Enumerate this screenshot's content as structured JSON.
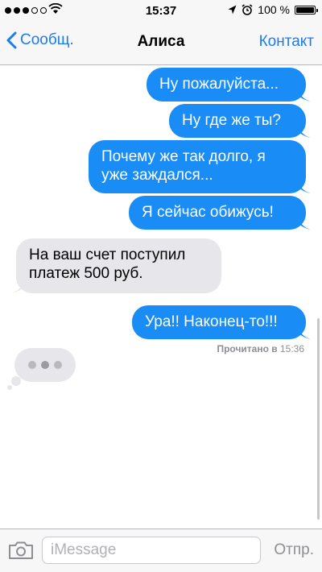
{
  "status_bar": {
    "time": "15:37",
    "battery_text": "100 %",
    "battery_level_pct": 100,
    "signal_bars_filled": 3,
    "signal_bars_total": 5
  },
  "nav": {
    "back_label": "Сообщ.",
    "title": "Алиса",
    "contact_label": "Контакт"
  },
  "messages": [
    {
      "direction": "outgoing",
      "text": "Ну пожалуйста..."
    },
    {
      "direction": "outgoing",
      "text": "Ну где же ты?"
    },
    {
      "direction": "outgoing",
      "line1": "Почему же так долго, я",
      "line2": "уже заждался..."
    },
    {
      "direction": "outgoing",
      "text": "Я сейчас обижусь!"
    },
    {
      "direction": "incoming",
      "line1": "На ваш счет поступил",
      "line2": "платеж 500 руб."
    },
    {
      "direction": "outgoing",
      "text": "Ура!! Наконец-то!!!"
    }
  ],
  "read_receipt": {
    "label": "Прочитано в",
    "time": "15:36"
  },
  "input_bar": {
    "placeholder": "iMessage",
    "send_label": "Отпр."
  },
  "colors": {
    "accent": "#1a7cf5",
    "outgoing_bubble": "#1a8cf5",
    "incoming_bubble": "#e6e6eb"
  },
  "icons": [
    "wifi-icon",
    "location-arrow-icon",
    "alarm-icon",
    "battery-icon",
    "chevron-left-icon",
    "camera-icon"
  ]
}
